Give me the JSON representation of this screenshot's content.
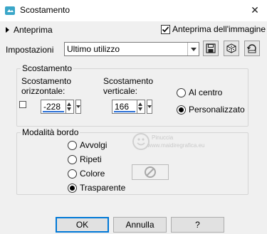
{
  "window": {
    "title": "Scostamento",
    "close_glyph": "✕",
    "app_icon": "app-icon"
  },
  "preview": {
    "label": "Anteprima",
    "on_image_label": "Anteprima dell'immagine",
    "on_image_checked": true
  },
  "presets": {
    "label": "Impostazioni",
    "value": "Ultimo utilizzo",
    "buttons": [
      "save-preset-icon",
      "random-icon",
      "reset-icon"
    ]
  },
  "offset": {
    "group_title": "Scostamento",
    "horizontal_label": "Scostamento orizzontale:",
    "horizontal_value": "-228",
    "vertical_label": "Scostamento verticale:",
    "vertical_value": "166",
    "center_label": "Al centro",
    "custom_label": "Personalizzato",
    "selected": "Personalizzato",
    "link_checked": false
  },
  "edge": {
    "group_title": "Modalità bordo",
    "options": [
      "Avvolgi",
      "Ripeti",
      "Colore",
      "Trasparente"
    ],
    "selected": "Trasparente"
  },
  "watermark": {
    "name": "Pinuccia",
    "site": "www.maidiregrafica.eu"
  },
  "buttons": {
    "ok": "OK",
    "cancel": "Annulla",
    "help": "?"
  },
  "colors": {
    "accent": "#0078d7",
    "spin_underline": "#2a6fd6",
    "title_icon": "#3aa6c8"
  }
}
